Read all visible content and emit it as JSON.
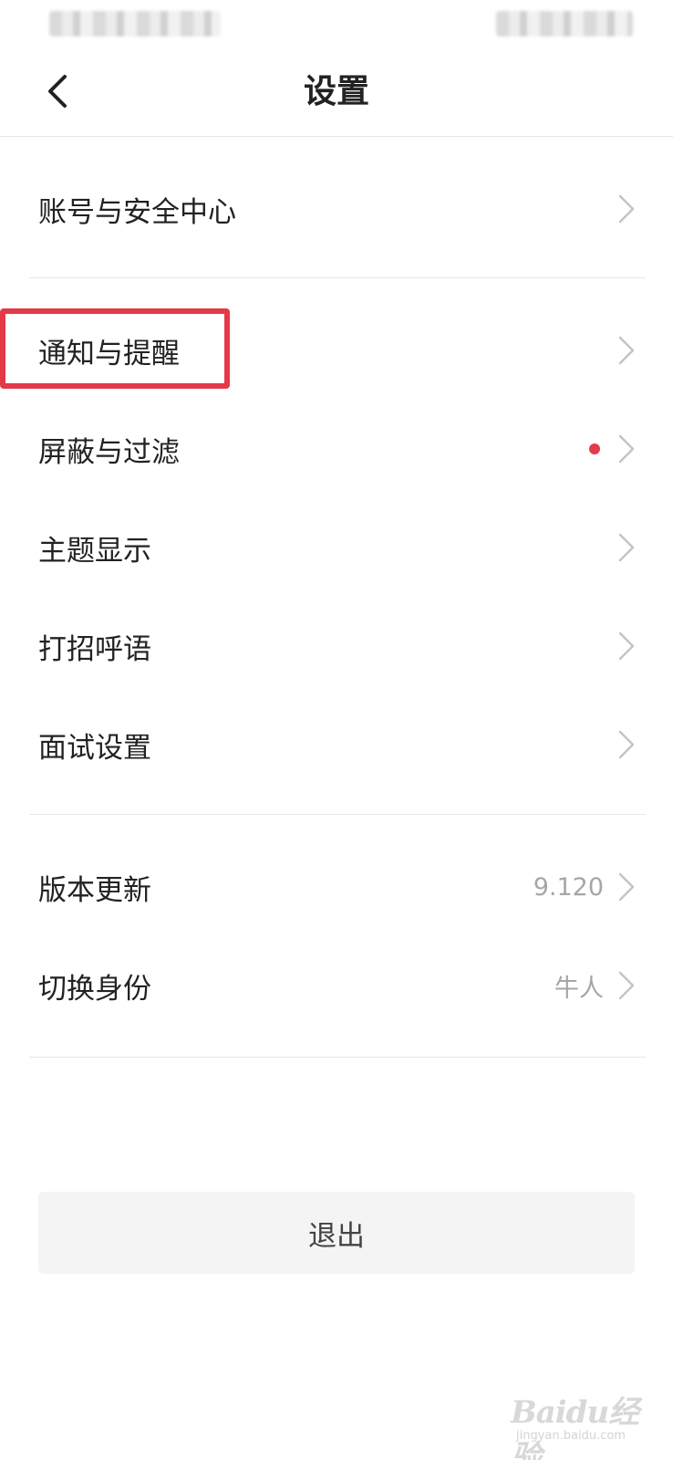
{
  "header": {
    "title": "设置"
  },
  "settings": {
    "group1": [
      {
        "label": "账号与安全中心"
      }
    ],
    "group2": [
      {
        "label": "通知与提醒"
      },
      {
        "label": "屏蔽与过滤",
        "badge": "red-dot"
      },
      {
        "label": "主题显示"
      },
      {
        "label": "打招呼语"
      },
      {
        "label": "面试设置"
      }
    ],
    "group3": [
      {
        "label": "版本更新",
        "value": "9.120"
      },
      {
        "label": "切换身份",
        "value": "牛人"
      }
    ]
  },
  "logout": {
    "label": "退出"
  },
  "watermark": {
    "main": "Baidu经验",
    "sub": "jingyan.baidu.com"
  },
  "colors": {
    "highlight": "#e4394a",
    "badge": "#e53a4b",
    "text": "#222222",
    "muted": "#a6a6a6"
  },
  "icons": {
    "back": "chevron-left-icon",
    "row": "chevron-right-icon"
  }
}
